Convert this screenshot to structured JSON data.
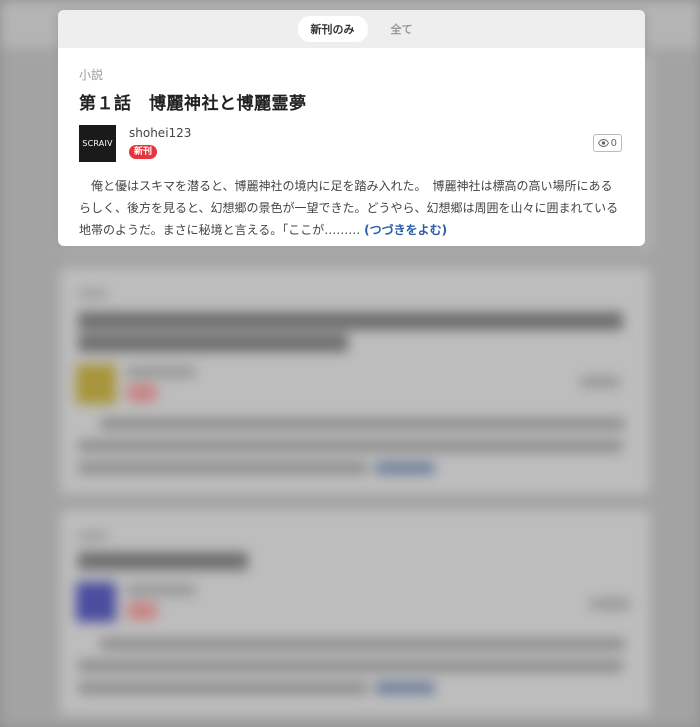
{
  "tabs": [
    {
      "label": "新刊のみ",
      "active": true
    },
    {
      "label": "全て",
      "active": false
    }
  ],
  "article": {
    "category": "小説",
    "title": "第１話　博麗神社と博麗霊夢",
    "author": {
      "name": "shohei123",
      "avatar_text": "SCRAIV"
    },
    "new_badge": "新刊",
    "view_count": "0",
    "excerpt": "　俺と優はスキマを潜ると、博麗神社の境内に足を踏み入れた。　博麗神社は標高の高い場所にあるらしく、後方を見ると、幻想郷の景色が一望できた。どうやら、幻想郷は周囲を山々に囲まれている地帯のようだ。まさに秘境と言える。「ここが………",
    "read_more": "(つづきをよむ)"
  },
  "colors": {
    "badge_red": "#e8343b",
    "link_blue": "#2b5ea8",
    "tabbar_bg": "#eeeeee"
  }
}
